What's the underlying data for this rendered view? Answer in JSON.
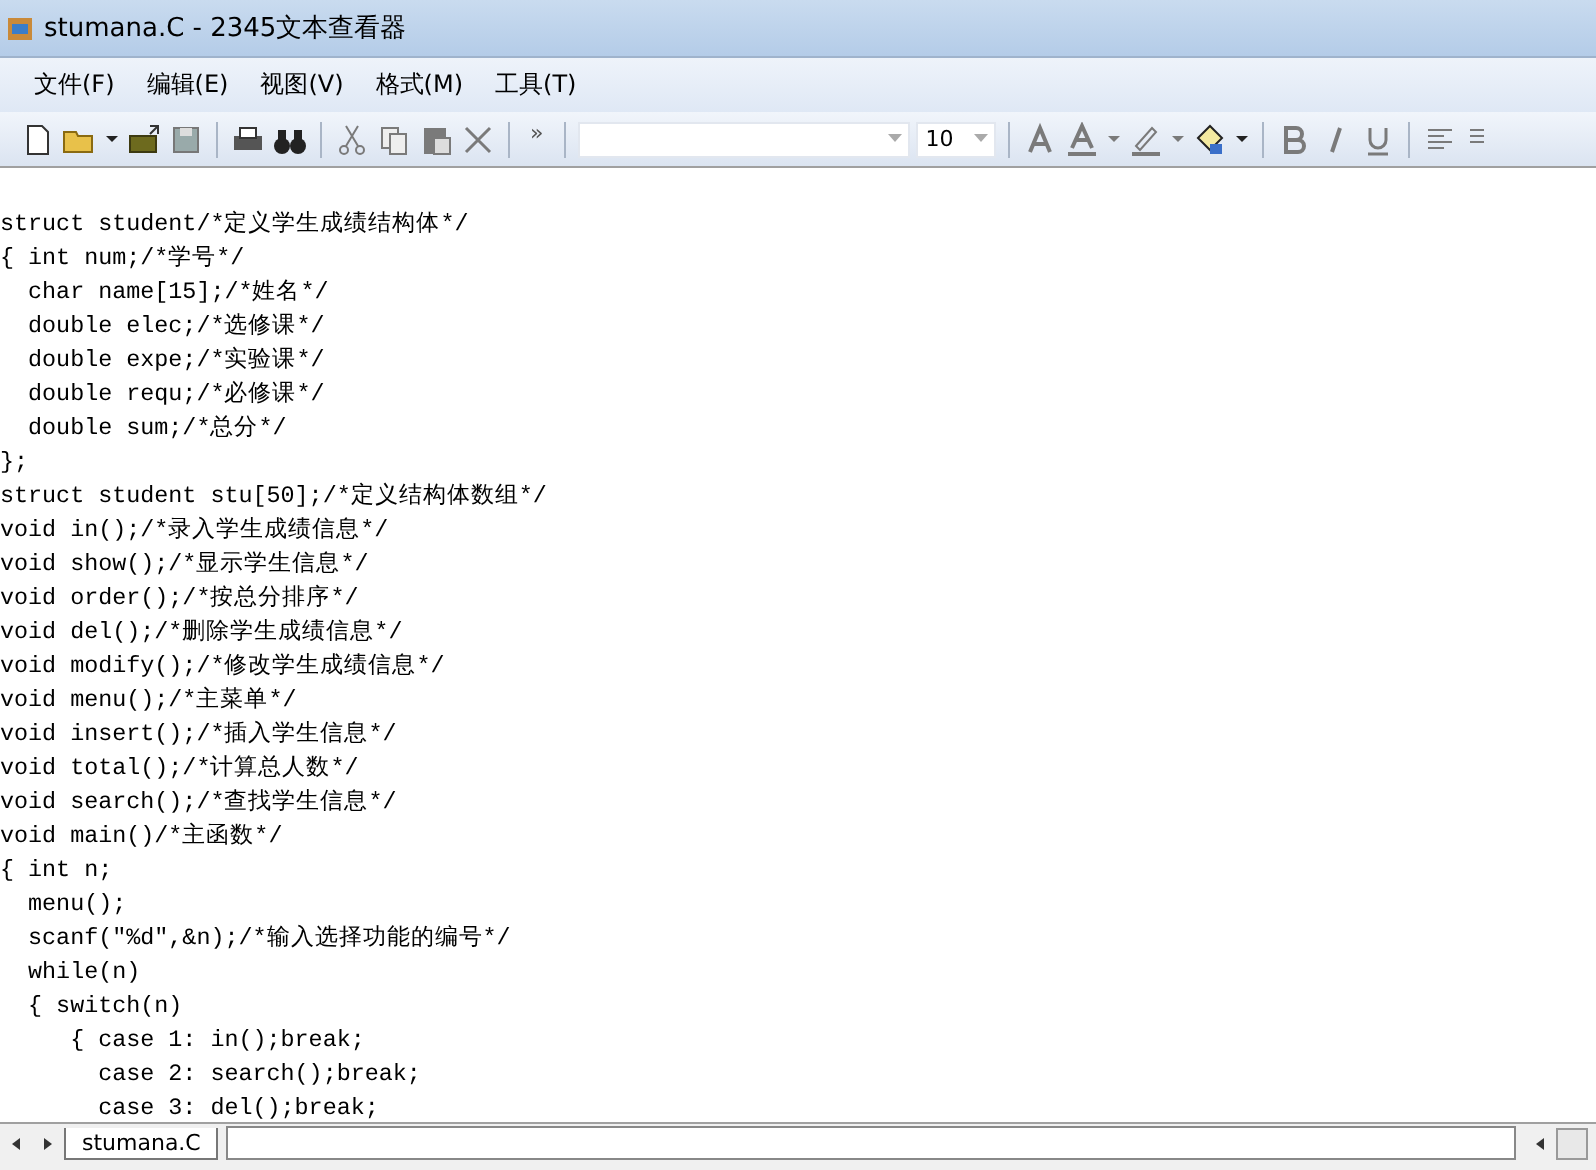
{
  "window": {
    "title": "stumana.C - 2345文本查看器"
  },
  "menu": [
    "文件(F)",
    "编辑(E)",
    "视图(V)",
    "格式(M)",
    "工具(T)"
  ],
  "toolbar": {
    "overflow": "»",
    "font_size": "10"
  },
  "code_lines": [
    "struct student/*定义学生成绩结构体*/",
    "{ int num;/*学号*/",
    "  char name[15];/*姓名*/",
    "  double elec;/*选修课*/",
    "  double expe;/*实验课*/",
    "  double requ;/*必修课*/",
    "  double sum;/*总分*/",
    "};",
    "struct student stu[50];/*定义结构体数组*/",
    "void in();/*录入学生成绩信息*/",
    "void show();/*显示学生信息*/",
    "void order();/*按总分排序*/",
    "void del();/*删除学生成绩信息*/",
    "void modify();/*修改学生成绩信息*/",
    "void menu();/*主菜单*/",
    "void insert();/*插入学生信息*/",
    "void total();/*计算总人数*/",
    "void search();/*查找学生信息*/",
    "void main()/*主函数*/",
    "{ int n;",
    "  menu();",
    "  scanf(\"%d\",&n);/*输入选择功能的编号*/",
    "  while(n)",
    "  { switch(n)",
    "     { case 1: in();break;",
    "       case 2: search();break;",
    "       case 3: del();break;"
  ],
  "tabs": [
    {
      "label": "stumana.C",
      "selected": true
    }
  ]
}
